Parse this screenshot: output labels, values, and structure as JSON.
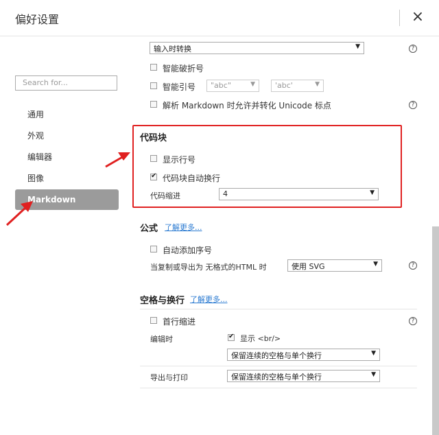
{
  "window": {
    "title": "偏好设置",
    "close_icon": "×"
  },
  "sidebar": {
    "search_placeholder": "Search for...",
    "items": [
      {
        "label": "通用"
      },
      {
        "label": "外观"
      },
      {
        "label": "编辑器"
      },
      {
        "label": "图像"
      },
      {
        "label": "Markdown"
      }
    ]
  },
  "top": {
    "convert_select": "输入时转换",
    "smart_dash": "智能破折号",
    "smart_quotes": "智能引号",
    "quote_opt1": "\"abc\"",
    "quote_opt2": "'abc'",
    "unicode_label": "解析 Markdown 时允许并转化 Unicode 标点"
  },
  "codeblock": {
    "heading": "代码块",
    "show_line_numbers": "显示行号",
    "auto_wrap": "代码块自动换行",
    "indent_label": "代码缩进",
    "indent_value": "4"
  },
  "math": {
    "heading": "公式",
    "learn_more": "了解更多...",
    "auto_number": "自动添加序号",
    "export_label": "当复制或导出为 无格式的HTML 时",
    "export_value": "使用 SVG"
  },
  "whitespace": {
    "heading": "空格与换行",
    "learn_more": "了解更多...",
    "first_indent": "首行缩进",
    "edit_label": "编辑时",
    "show_br": "显示 <br/>",
    "edit_select": "保留连续的空格与单个换行",
    "export_label": "导出与打印",
    "export_select": "保留连续的空格与单个换行"
  },
  "help_glyph": "?",
  "colors": {
    "accent": "#e02020",
    "active_nav": "#9b9b9b",
    "link": "#2a7ad1"
  }
}
